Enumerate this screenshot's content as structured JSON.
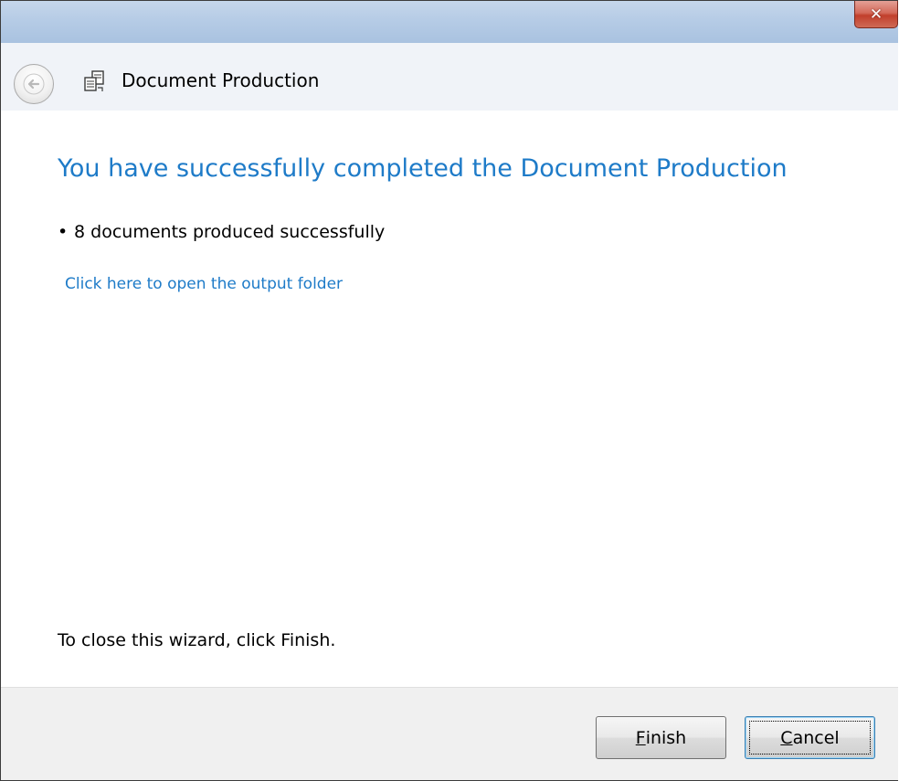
{
  "window": {
    "close_glyph": "✕",
    "title": "Document Production",
    "back_icon": "back-arrow-icon",
    "app_icon": "document-production-icon"
  },
  "content": {
    "heading": "You have successfully completed the Document Production",
    "bullet": "•",
    "result_text": "8 documents produced successfully",
    "output_link": "Click here to open the output folder",
    "close_hint": "To close this wizard, click Finish."
  },
  "footer": {
    "finish_accel": "F",
    "finish_rest": "inish",
    "cancel_accel": "C",
    "cancel_rest": "ancel"
  },
  "colors": {
    "heading": "#1e7bc8",
    "link": "#1e7bc8",
    "footer_bg": "#f0f0f0"
  }
}
